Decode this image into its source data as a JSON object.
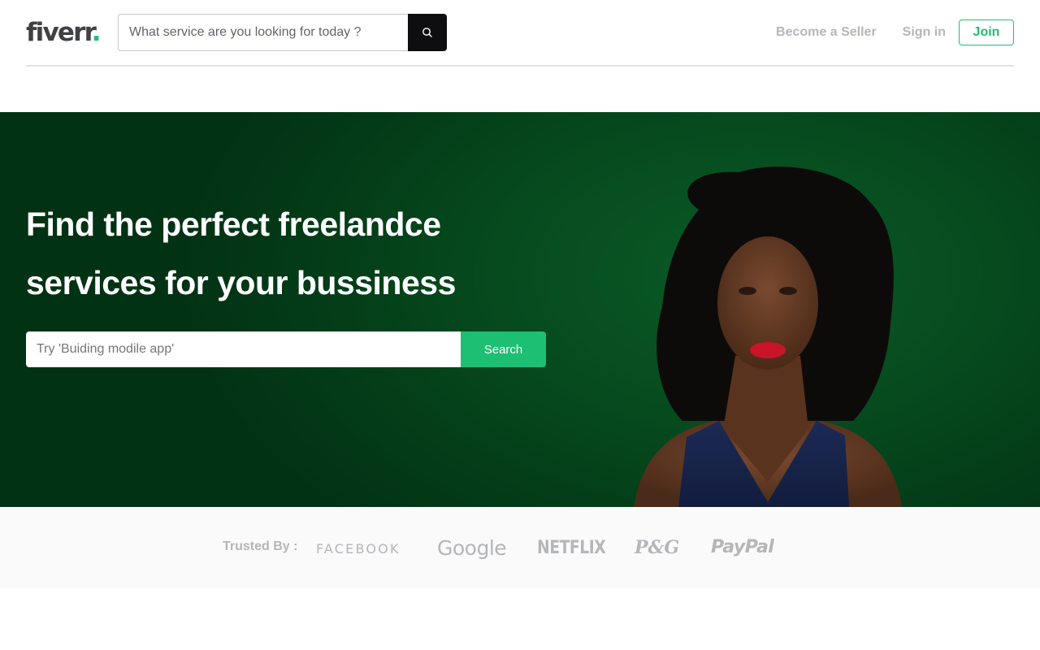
{
  "header": {
    "logo_text": "fiverr",
    "logo_dot": ".",
    "search_placeholder": "What service are you looking for today ?",
    "nav": {
      "become_seller": "Become a Seller",
      "sign_in": "Sign in",
      "join": "Join"
    }
  },
  "hero": {
    "title_line1": "Find the perfect freelandce",
    "title_line2": "services for your bussiness",
    "search_placeholder": "Try 'Buiding modile app'",
    "search_button": "Search"
  },
  "trusted": {
    "label": "Trusted By :",
    "brands": [
      "FACEBOOK",
      "Google",
      "NETFLIX",
      "P&G",
      "PayPal"
    ]
  },
  "colors": {
    "brand_green": "#1dbf73",
    "hero_bg": "#034019",
    "search_button_dark": "#0e0e10"
  },
  "icons": {
    "top_search": "search-icon"
  }
}
